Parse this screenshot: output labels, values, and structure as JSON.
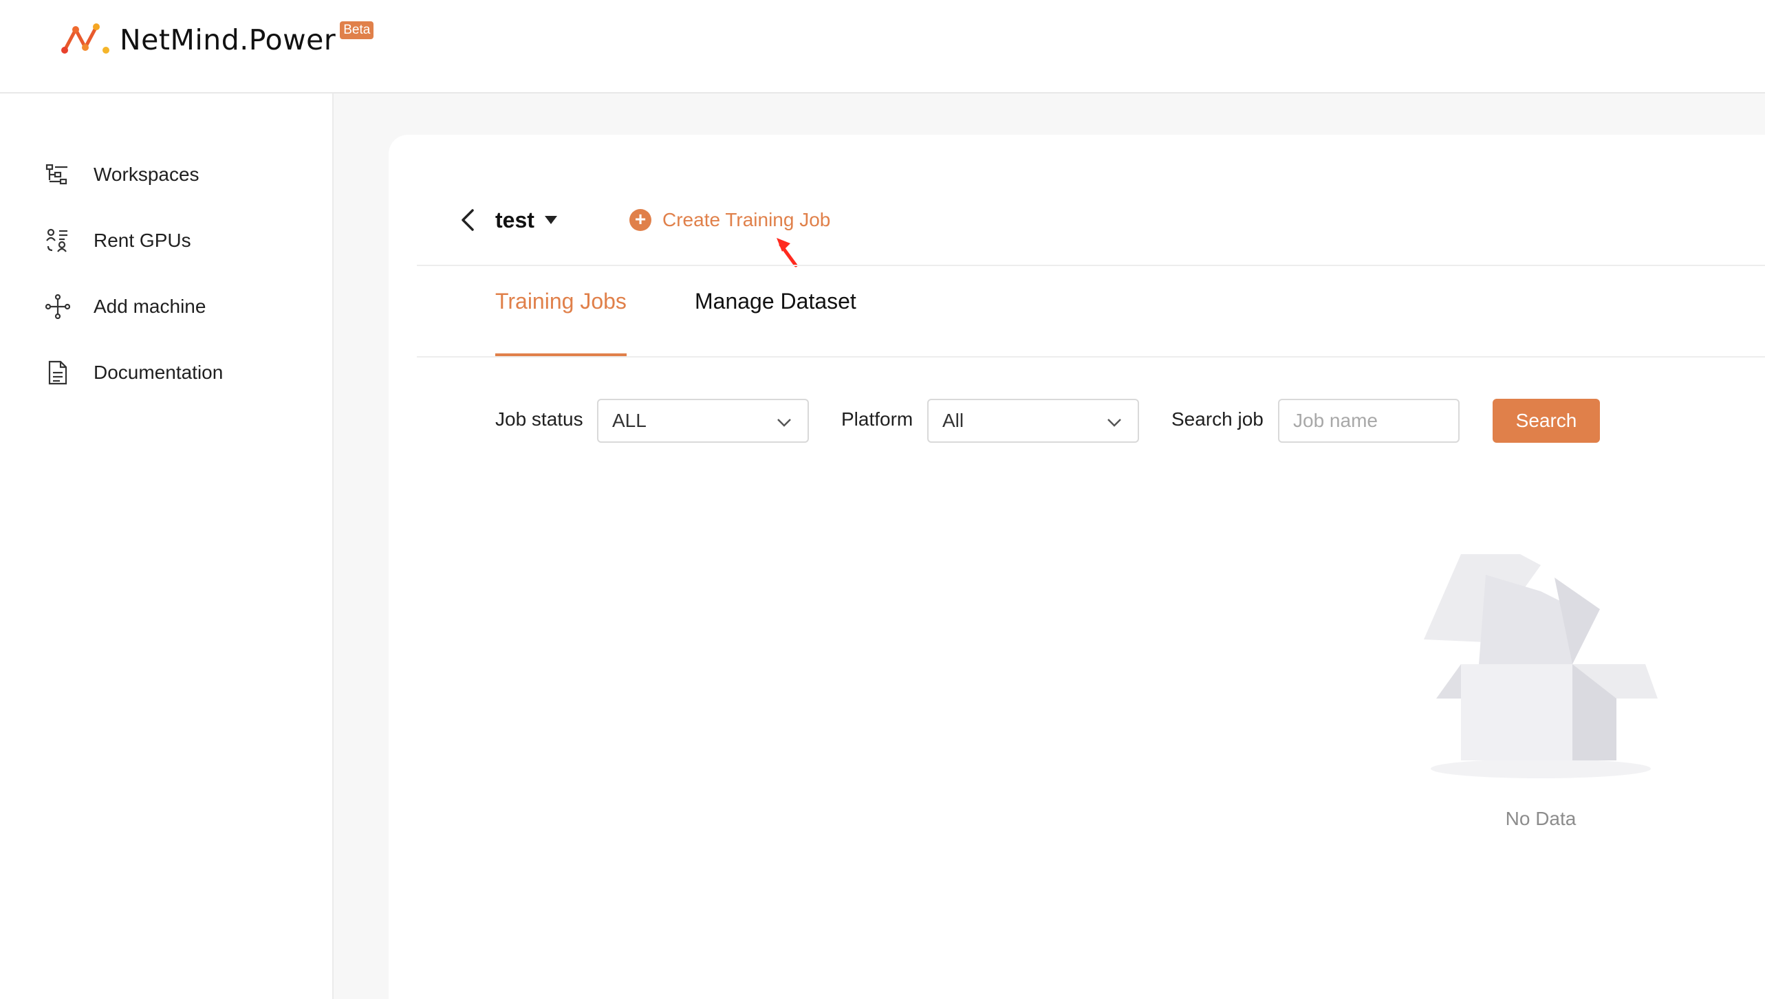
{
  "brand": {
    "name": "NetMind.Power",
    "badge": "Beta"
  },
  "sidebar": {
    "items": [
      {
        "label": "Workspaces",
        "icon": "workspaces-icon"
      },
      {
        "label": "Rent GPUs",
        "icon": "rent-gpus-icon"
      },
      {
        "label": "Add machine",
        "icon": "add-machine-icon"
      },
      {
        "label": "Documentation",
        "icon": "documentation-icon"
      }
    ]
  },
  "workspace": {
    "name": "test",
    "create_label": "Create Training Job"
  },
  "tabs": [
    {
      "label": "Training Jobs",
      "active": true
    },
    {
      "label": "Manage Dataset",
      "active": false
    }
  ],
  "filters": {
    "job_status_label": "Job status",
    "job_status_value": "ALL",
    "platform_label": "Platform",
    "platform_value": "All",
    "search_label": "Search job",
    "search_placeholder": "Job name",
    "search_button": "Search"
  },
  "empty_state": {
    "text": "No Data"
  },
  "colors": {
    "accent": "#e0804a",
    "cursor": "#ff2a1f"
  }
}
